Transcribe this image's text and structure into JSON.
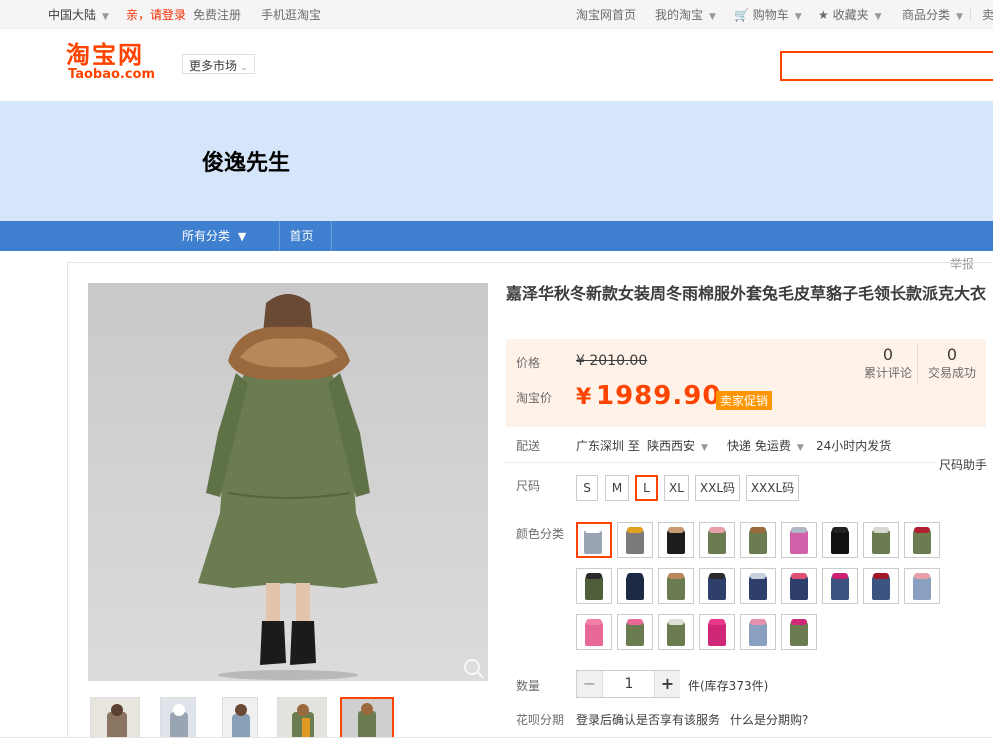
{
  "topbar": {
    "region": "中国大陆",
    "login": "亲，请登录",
    "register": "免费注册",
    "mobile": "手机逛淘宝",
    "home": "淘宝网首页",
    "mytaobao": "我的淘宝",
    "cart": "购物车",
    "fav": "收藏夹",
    "categories": "商品分类",
    "more": "卖"
  },
  "header": {
    "logo_cn": "淘宝网",
    "logo_en": "Taobao.com",
    "market": "更多市场"
  },
  "shop": {
    "name": "俊逸先生",
    "nav_all": "所有分类",
    "nav_home": "首页"
  },
  "report": "举报",
  "product": {
    "title": "嘉泽华秋冬新款女装周冬雨棉服外套兔毛皮草貉子毛领长款派克大衣",
    "price_label": "价格",
    "original_price": "¥ 2010.00",
    "taobao_label": "淘宝价",
    "yen": "¥",
    "price": "1989.90",
    "promo": "卖家促销",
    "reviews_count": "0",
    "reviews_label": "累计评论",
    "sales_count": "0",
    "sales_label": "交易成功"
  },
  "shipping": {
    "label": "配送",
    "from": "广东深圳 至",
    "to": "陕西西安",
    "method": "快递 免运费",
    "time": "24小时内发货"
  },
  "size": {
    "label": "尺码",
    "help": "尺码助手",
    "options": [
      "S",
      "M",
      "L",
      "XL",
      "XXL码",
      "XXXL码"
    ],
    "selected": "L"
  },
  "color": {
    "label": "颜色分类"
  },
  "quantity": {
    "label": "数量",
    "minus": "−",
    "value": "1",
    "plus": "+",
    "stock": "件(库存373件)"
  },
  "installment": {
    "label": "花呗分期",
    "text": "登录后确认是否享有该服务",
    "link": "什么是分期购?"
  },
  "colors": {
    "accent": "#ff4400",
    "nav": "#3f7fcf",
    "banner": "#d6e6fa",
    "pricebg": "#fff2e8"
  }
}
